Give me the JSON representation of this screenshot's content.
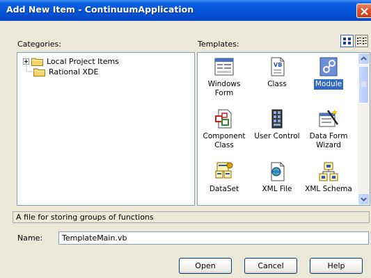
{
  "window": {
    "title": "Add New Item - ContinuumApplication"
  },
  "categories": {
    "label": "Categories:",
    "items": [
      {
        "label": "Local Project Items",
        "expandable": true,
        "selected": true
      },
      {
        "label": "Rational XDE",
        "expandable": false,
        "selected": false
      }
    ]
  },
  "templates": {
    "label": "Templates:",
    "items": [
      {
        "label": "Windows Form",
        "icon": "windows-form-icon",
        "selected": false
      },
      {
        "label": "Class",
        "icon": "class-icon",
        "selected": false
      },
      {
        "label": "Module",
        "icon": "module-icon",
        "selected": true
      },
      {
        "label": "Component Class",
        "icon": "component-class-icon",
        "selected": false
      },
      {
        "label": "User Control",
        "icon": "user-control-icon",
        "selected": false
      },
      {
        "label": "Data Form Wizard",
        "icon": "data-form-wizard-icon",
        "selected": false
      },
      {
        "label": "DataSet",
        "icon": "dataset-icon",
        "selected": false
      },
      {
        "label": "XML File",
        "icon": "xml-file-icon",
        "selected": false
      },
      {
        "label": "XML Schema",
        "icon": "xml-schema-icon",
        "selected": false
      }
    ],
    "view_modes": [
      "large-icons-view",
      "small-icons-view"
    ],
    "active_view": "large-icons-view"
  },
  "description": "A file for storing groups of functions",
  "name_field": {
    "label": "Name:",
    "value": "TemplateMain.vb"
  },
  "buttons": {
    "open": "Open",
    "cancel": "Cancel",
    "help": "Help"
  },
  "colors": {
    "selection": "#316ac5",
    "titlebar": "#0553d8",
    "dialog_bg": "#ece9d8",
    "close": "#d74d26"
  }
}
